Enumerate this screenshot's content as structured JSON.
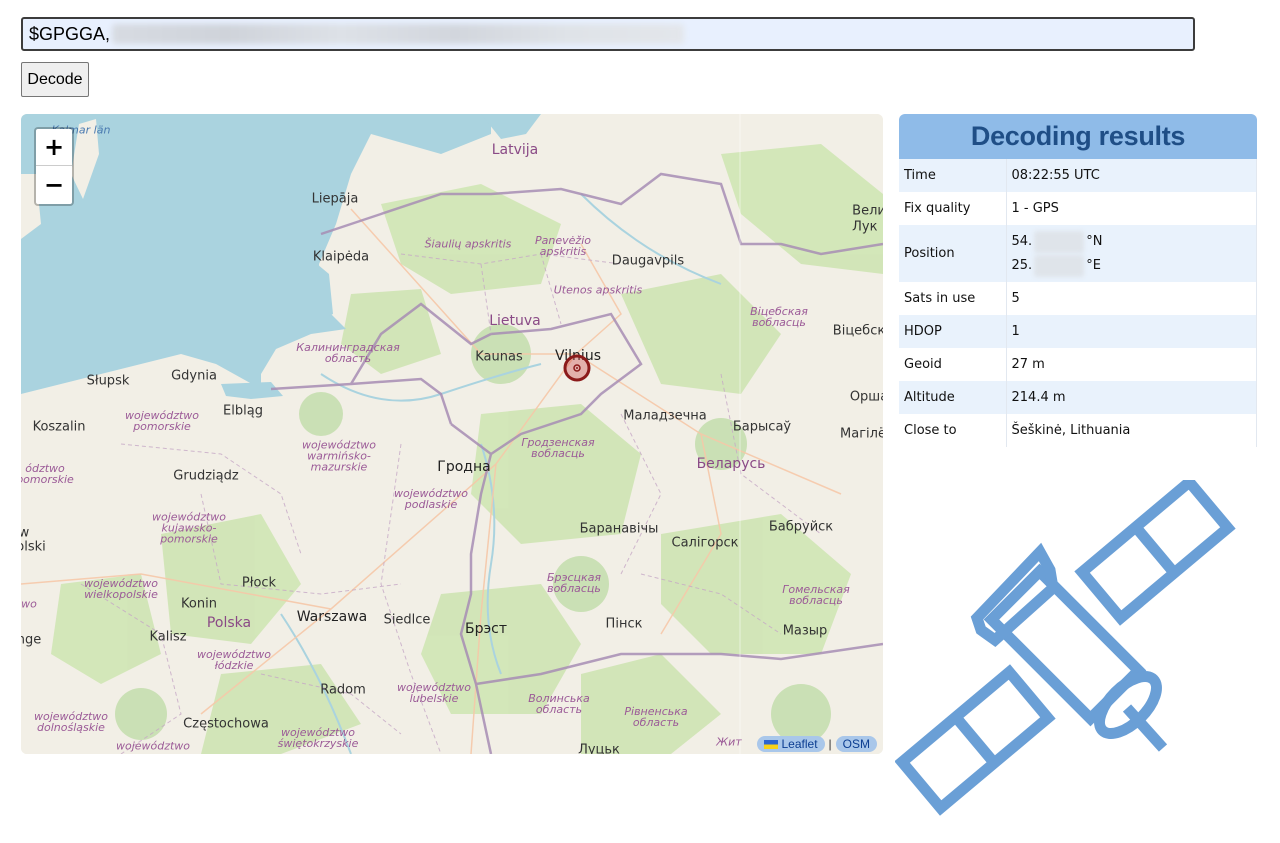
{
  "input": {
    "prefix": "$GPGGA,",
    "value": "$GPGGA,"
  },
  "decode_button": "Decode",
  "map": {
    "zoom_in": "+",
    "zoom_out": "−",
    "attribution": {
      "leaflet": "Leaflet",
      "separator": "|",
      "osm": "OSM"
    },
    "labels": {
      "latvija": "Latvija",
      "lietuva": "Lietuva",
      "polska": "Polska",
      "belarus": "Беларусь",
      "kalmar": "Kalmar län",
      "liepaja": "Liepāja",
      "klaipeda": "Klaipėda",
      "siauliu": "Šiaulių apskritis",
      "panevezio": "Panevėžio\napskritis",
      "daugavpils": "Daugavpils",
      "utenos": "Utenos apskritis",
      "kaliningrad": "Калининградская\nобласть",
      "kaunas": "Kaunas",
      "vilnius": "Vilnius",
      "slupsk": "Słupsk",
      "gdynia": "Gdynia",
      "elblag": "Elbląg",
      "pomorskie": "województwo\npomorskie",
      "warminsko": "województwo\nwarmińsko-\nmazurskie",
      "koszalin": "Koszalin",
      "grudziadz": "Grudziądz",
      "hrodna": "Гродна",
      "hrodna_obl": "Гродзенская\nвобласць",
      "podlaskie": "województwo\npodlaskie",
      "maladzechna": "Маладзечна",
      "barysau": "Барысаў",
      "kujawsko": "województwo\nkujawsko-\npomorskie",
      "plock": "Płock",
      "konin": "Konin",
      "warszawa": "Warszawa",
      "siedlce": "Siedlce",
      "brest": "Брэст",
      "brest_obl": "Брэсцкая\nвобласць",
      "baranavichy": "Баранавічы",
      "salihorsk": "Салігорск",
      "babruisk": "Бабруйск",
      "pinsk": "Пінск",
      "mazyr": "Мазыр",
      "homel_obl": "Гомельская\nвобласць",
      "wielkopolskie": "województwo\nwielkopolskie",
      "kalisz": "Kalisz",
      "lodzkie": "województwo\nłódzkie",
      "radom": "Radom",
      "lubelskie": "województwo\nlubelskie",
      "czestochowa": "Częstochowa",
      "swietokrzyskie": "województwo\nświętokrzyskie",
      "dolnoslaskie": "województwo\ndolnośląskie",
      "volyn": "Волинська\nобласть",
      "rivne": "Рівненська\nобласть",
      "vitebsk_obl": "Віцебская\nвобласць",
      "vitebsk": "Віцебск",
      "orsha": "Орша",
      "mahilyow": "Магілё",
      "velikie": "Вели\nЛук",
      "lutsk": "Луцьк",
      "zhyt": "Жит",
      "pomorskie_left": "ództwo\npomorskie",
      "slski": "olski",
      "w_left": "w",
      "wo_left": "wo",
      "nge_left": "nge",
      "wo_bottom": "województwo"
    }
  },
  "results": {
    "title": "Decoding results",
    "rows": [
      {
        "label": "Time",
        "value": "08:22:55 UTC"
      },
      {
        "label": "Fix quality",
        "value": "1 - GPS"
      },
      {
        "label": "Position",
        "lat_prefix": "54.",
        "lat_suffix": "°N",
        "lon_prefix": "25.",
        "lon_suffix": "°E"
      },
      {
        "label": "Sats in use",
        "value": "5"
      },
      {
        "label": "HDOP",
        "value": "1"
      },
      {
        "label": "Geoid",
        "value": "27 m"
      },
      {
        "label": "Altitude",
        "value": "214.4 m"
      },
      {
        "label": "Close to",
        "value": "Šeškinė, Lithuania"
      }
    ]
  },
  "colors": {
    "accent": "#8fbbe8",
    "title_text": "#1f4e86",
    "row_alt": "#e9f2fc",
    "satellite_icon": "#6a9fd6",
    "marker": "#8b1a1a"
  },
  "icons": {
    "satellite": "satellite-icon",
    "marker": "location-marker-icon"
  }
}
